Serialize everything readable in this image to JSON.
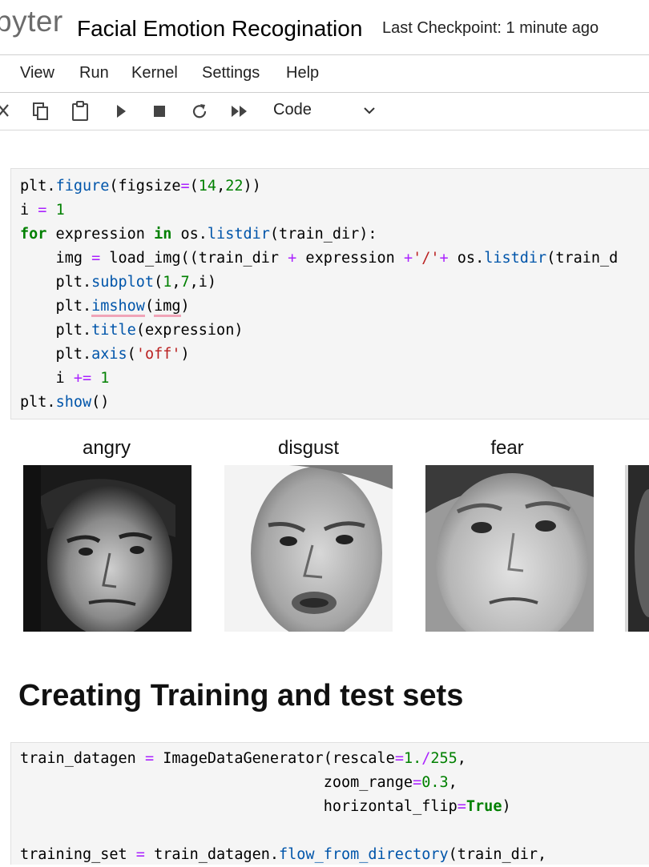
{
  "header": {
    "logo_text": "pyter",
    "notebook_title": "Facial Emotion Recogination",
    "checkpoint": "Last Checkpoint: 1 minute ago"
  },
  "menu": [
    "View",
    "Run",
    "Kernel",
    "Settings",
    "Help"
  ],
  "toolbar": {
    "icons": [
      "cut-icon",
      "copy-icon",
      "paste-icon",
      "run-icon",
      "stop-icon",
      "restart-icon",
      "fast-forward-icon"
    ],
    "cell_type": "Code"
  },
  "cell1": {
    "lines": [
      "plt.figure(figsize=(14,22))",
      "i = 1",
      "for expression in os.listdir(train_dir):",
      "    img = load_img((train_dir + expression +'/'+ os.listdir(train_d",
      "    plt.subplot(1,7,i)",
      "    plt.imshow(img)",
      "    plt.title(expression)",
      "    plt.axis('off')",
      "    i += 1",
      "plt.show()"
    ]
  },
  "output": {
    "titles": [
      "angry",
      "disgust",
      "fear"
    ]
  },
  "markdown": {
    "heading": "Creating Training and test sets"
  },
  "cell2": {
    "lines": [
      "train_datagen = ImageDataGenerator(rescale=1./255,",
      "                                  zoom_range=0.3,",
      "                                  horizontal_flip=True)",
      "",
      "training_set = train_datagen.flow_from_directory(train_dir,"
    ]
  },
  "colors": {
    "keyword": "#008000",
    "operator": "#aa22ff",
    "string": "#ba2121",
    "function": "#0055aa",
    "cell_bg": "#f5f5f5"
  }
}
